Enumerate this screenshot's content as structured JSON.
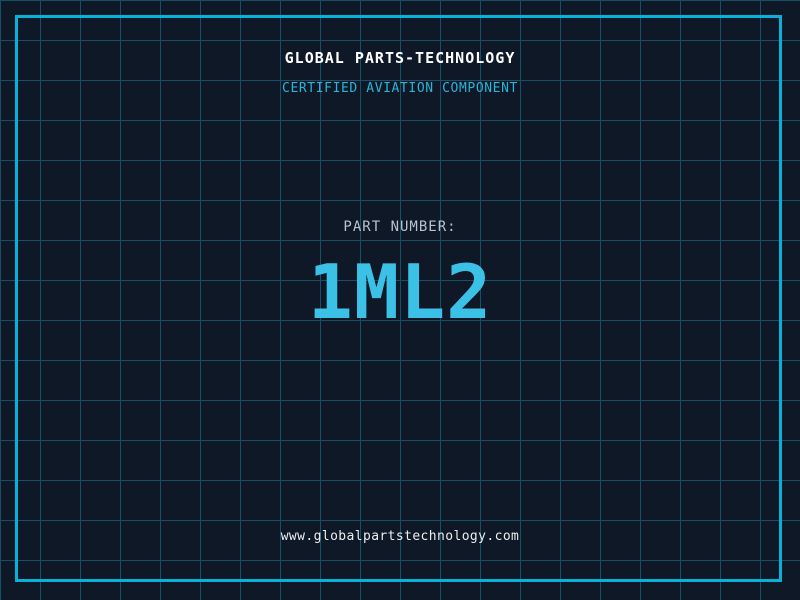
{
  "label": {
    "company_name": "GLOBAL PARTS-TECHNOLOGY",
    "subtitle": "CERTIFIED AVIATION COMPONENT",
    "part_number_label": "PART NUMBER:",
    "part_number": "1ML2",
    "website": "www.globalpartstechnology.com"
  },
  "colors": {
    "background": "#0f1826",
    "grid_line": "#17506a",
    "frame_border": "#07b1d8",
    "company_text": "#ffffff",
    "subtitle_text": "#2bb3d8",
    "part_label_text": "#b9c2ce",
    "part_number_text": "#3cc1e6",
    "website_text": "#eceef2"
  }
}
